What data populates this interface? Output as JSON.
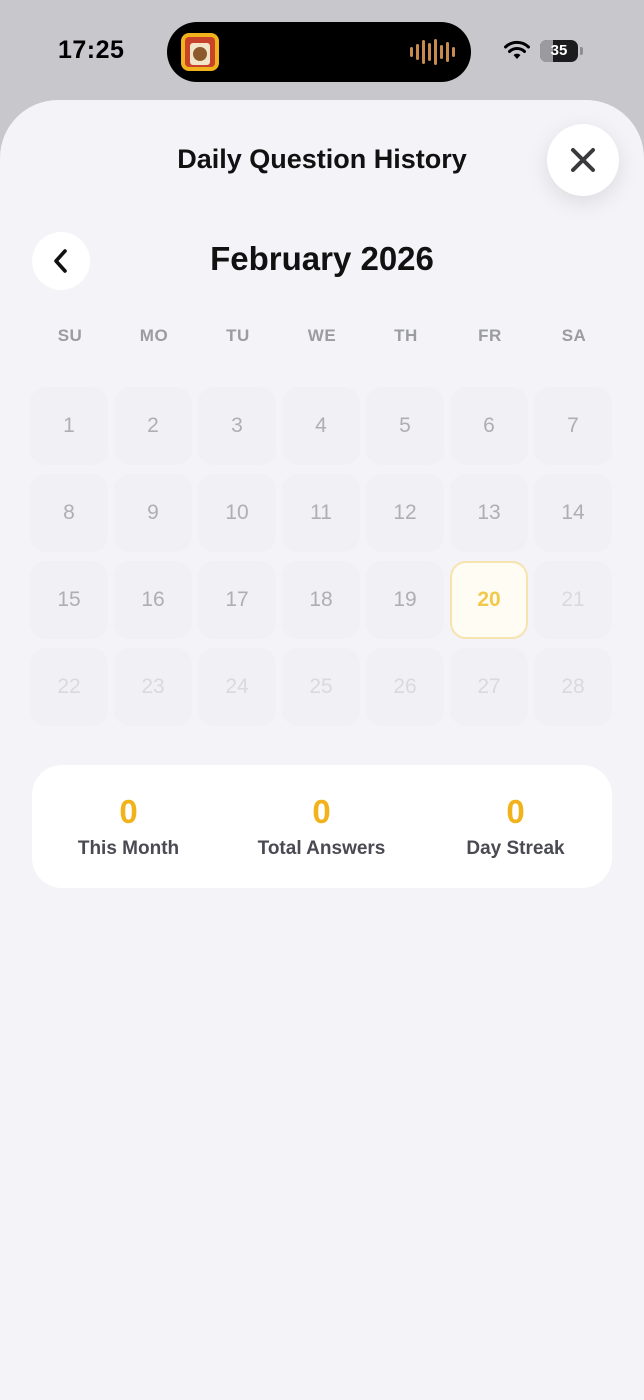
{
  "status_bar": {
    "time": "17:25",
    "battery_percent": "35",
    "battery_level": 0.35,
    "icons": [
      "wifi-icon",
      "battery-icon",
      "audio-waveform-icon",
      "app-thumbnail-icon"
    ]
  },
  "sheet": {
    "title": "Daily Question History",
    "close_icon": "close-icon"
  },
  "calendar": {
    "back_icon": "chevron-left-icon",
    "month_label": "February 2026",
    "weekdays": [
      "SU",
      "MO",
      "TU",
      "WE",
      "TH",
      "FR",
      "SA"
    ],
    "days": [
      "1",
      "2",
      "3",
      "4",
      "5",
      "6",
      "7",
      "8",
      "9",
      "10",
      "11",
      "12",
      "13",
      "14",
      "15",
      "16",
      "17",
      "18",
      "19",
      "20",
      "21",
      "22",
      "23",
      "24",
      "25",
      "26",
      "27",
      "28"
    ],
    "today": "20",
    "accent_color": "#F2B21B"
  },
  "stats": {
    "this_month": {
      "value": "0",
      "label": "This Month"
    },
    "total_answers": {
      "value": "0",
      "label": "Total Answers"
    },
    "day_streak": {
      "value": "0",
      "label": "Day Streak"
    }
  }
}
